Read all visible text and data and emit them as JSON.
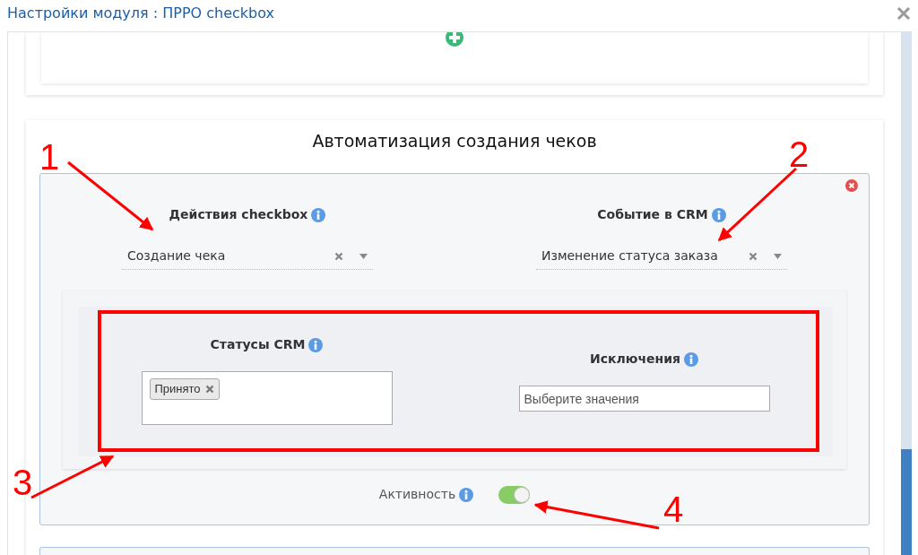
{
  "dialog": {
    "title": "Настройки модуля : ПРРО checkbox"
  },
  "section": {
    "title": "Автоматизация создания чеков"
  },
  "rule": {
    "fields": [
      {
        "label": "Действия checkbox",
        "value": "Создание чека"
      },
      {
        "label": "Событие в CRM",
        "value": "Изменение статуса заказа"
      }
    ],
    "conditions": [
      {
        "kind": "tags",
        "label": "Статусы CRM",
        "tags": [
          "Принято"
        ]
      },
      {
        "kind": "input",
        "label": "Исключения",
        "placeholder": "Выберите значения"
      }
    ],
    "active_label": "Активность",
    "active": true
  },
  "annotations": [
    "1",
    "2",
    "3",
    "4"
  ]
}
